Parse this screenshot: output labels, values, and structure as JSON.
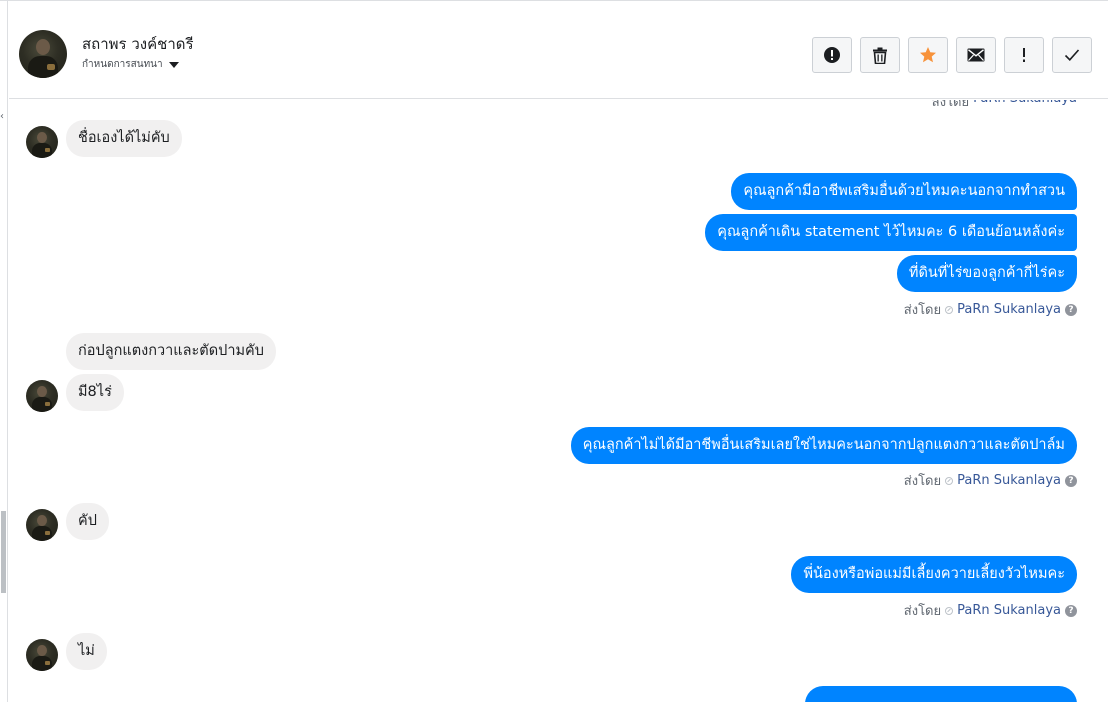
{
  "header": {
    "contact_name": "สถาพร วงค์ชาดรี",
    "subtitle": "กำหนดการสนทนา",
    "actions": [
      {
        "name": "spam-report-button",
        "icon": "exclamation-circle-icon"
      },
      {
        "name": "delete-button",
        "icon": "trash-icon"
      },
      {
        "name": "star-button",
        "icon": "star-icon",
        "color": "#f7923a"
      },
      {
        "name": "mark-unread-button",
        "icon": "envelope-icon"
      },
      {
        "name": "flag-button",
        "icon": "exclamation-icon"
      },
      {
        "name": "mark-done-button",
        "icon": "check-icon"
      }
    ]
  },
  "colors": {
    "outgoing_bubble": "#0084ff",
    "incoming_bubble": "#f1f0f0",
    "agent_name": "#385898"
  },
  "messages": {
    "clipped_top": {
      "prefix": "ส่งโดย",
      "agent": "PaRn Sukanlaya"
    },
    "m1": "ชื่อเองได้ไม่คับ",
    "m2": "คุณลูกค้ามีอาชีพเสริมอื่นด้วยไหมคะนอกจากทำสวน",
    "m3": "คุณลูกค้าเดิน statement ไว้ไหมคะ 6 เดือนย้อนหลังค่ะ",
    "m4": "ที่ดินที่ไร่ของลูกค้ากี่ไร่คะ",
    "sent_by_1": {
      "prefix": "ส่งโดย",
      "agent": "PaRn Sukanlaya"
    },
    "m5": "ก่อปลูกแตงกวาและตัดปามคับ",
    "m6": "มี8ไร่",
    "m7": "คุณลูกค้าไม่ได้มีอาชีพอื่นเสริมเลยใช่ไหมคะนอกจากปลูกแตงกวาและตัดปาล์ม",
    "sent_by_2": {
      "prefix": "ส่งโดย",
      "agent": "PaRn Sukanlaya"
    },
    "m8": "คัป",
    "m9": "พี่น้องหรือพ่อแม่มีเลี้ยงควายเลี้ยงวัวไหมคะ",
    "sent_by_3": {
      "prefix": "ส่งโดย",
      "agent": "PaRn Sukanlaya"
    },
    "m10": "ไม่"
  }
}
